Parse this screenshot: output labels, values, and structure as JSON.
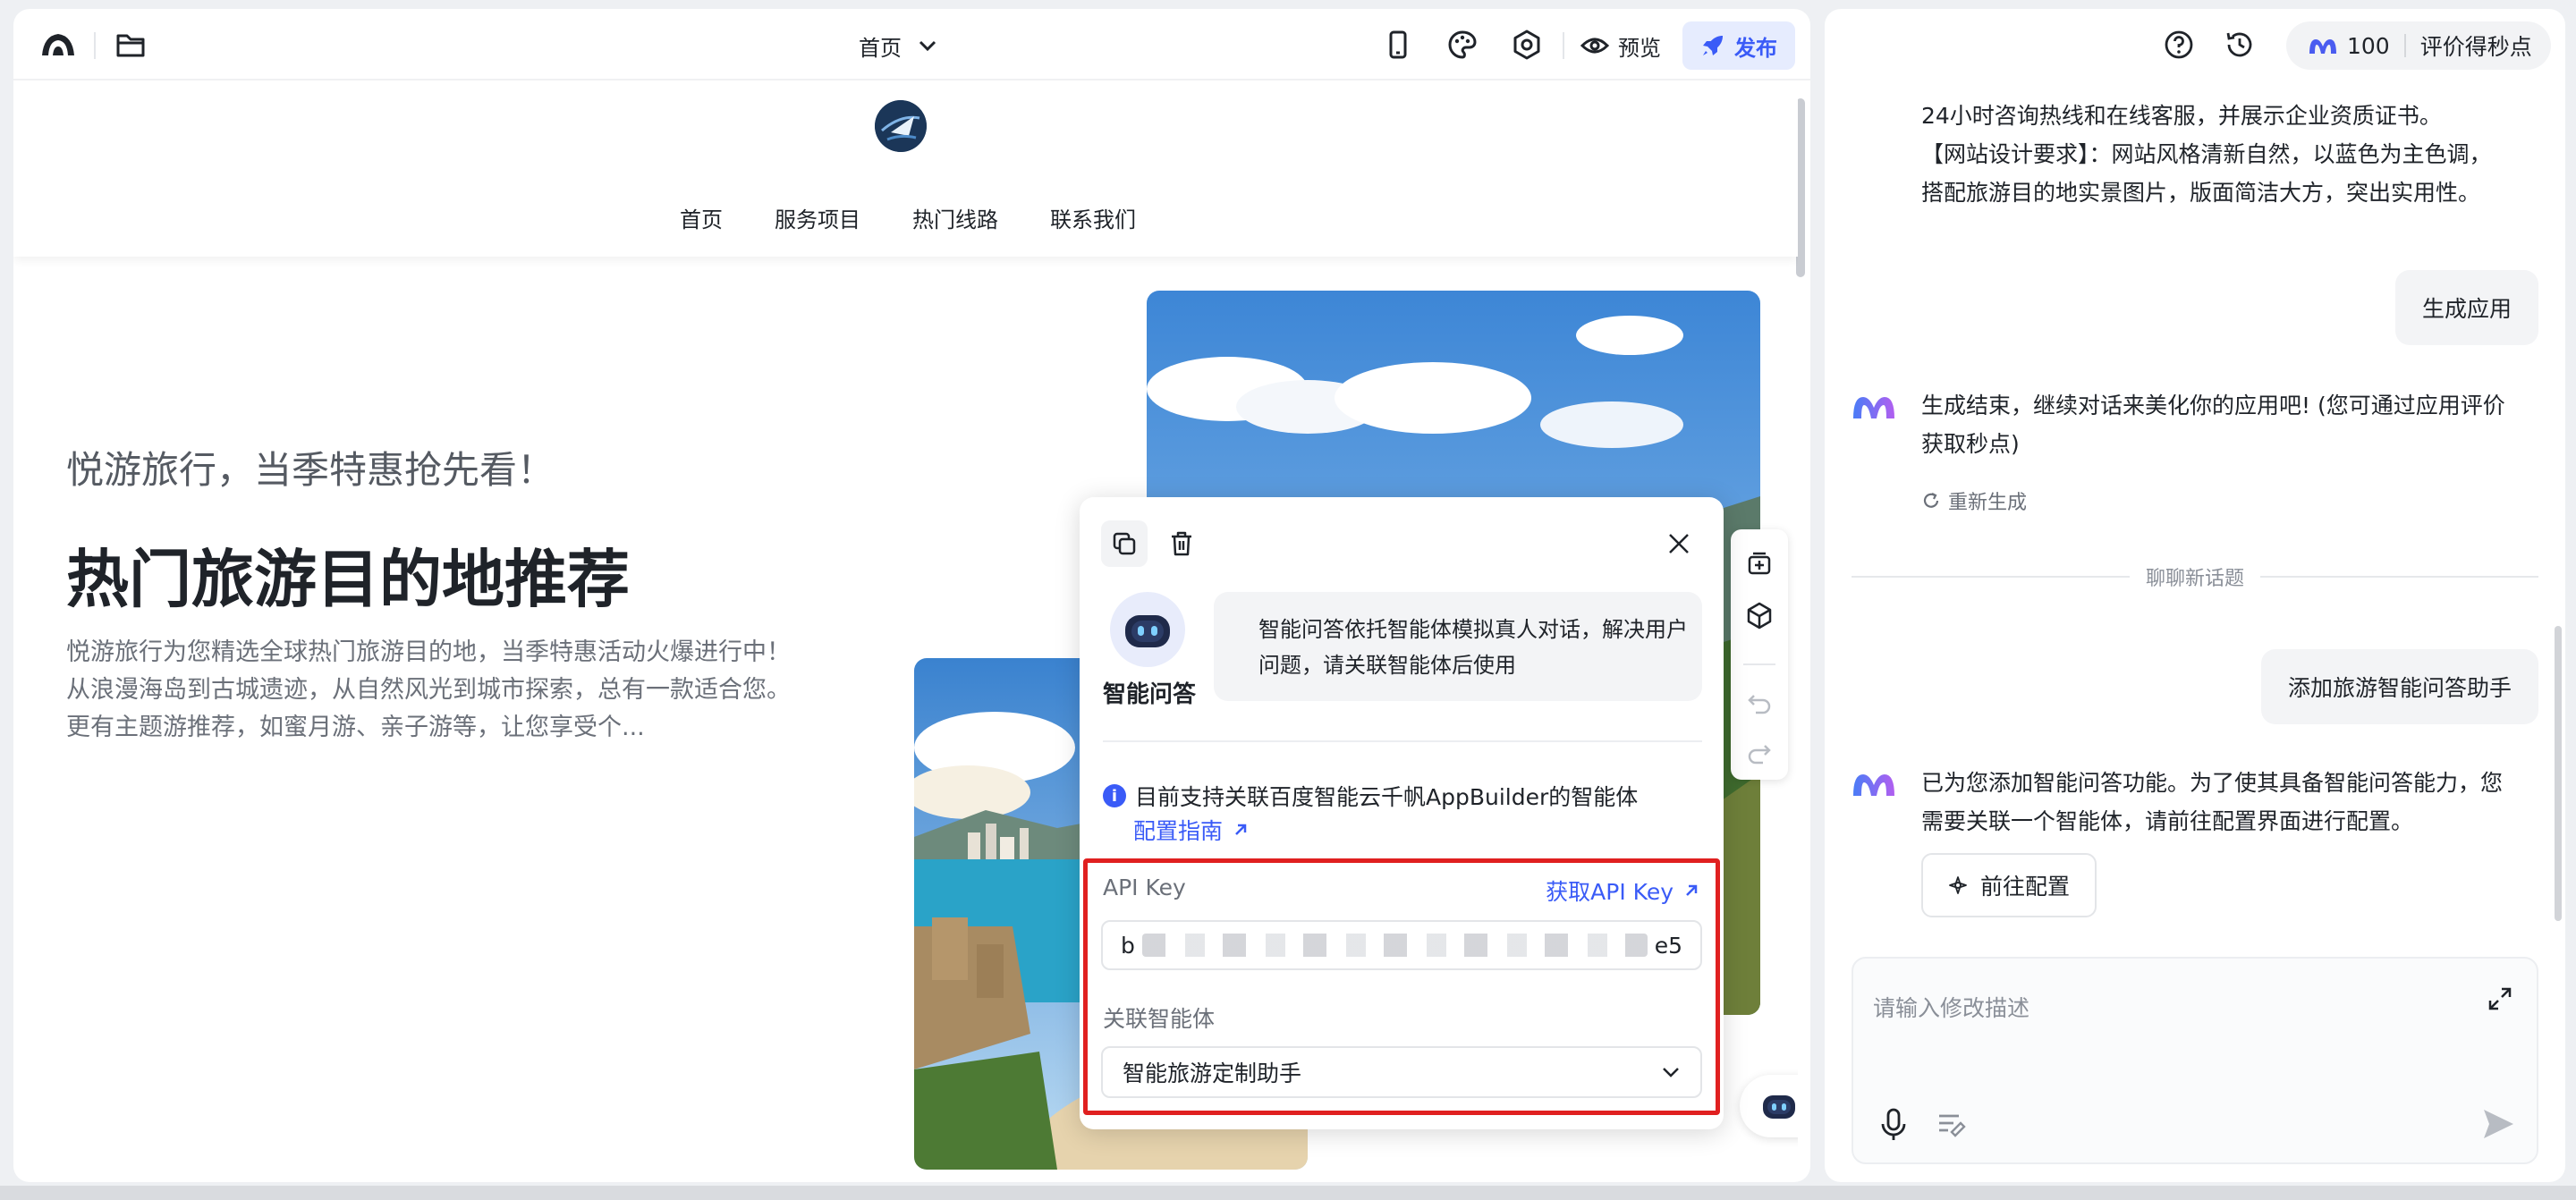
{
  "toolbar": {
    "page_select": "首页",
    "preview_label": "预览",
    "publish_label": "发布"
  },
  "site": {
    "nav": [
      "首页",
      "服务项目",
      "热门线路",
      "联系我们"
    ],
    "hero_subtitle": "悦游旅行，当季特惠抢先看！",
    "hero_title": "热门旅游目的地推荐",
    "hero_desc": "悦游旅行为您精选全球热门旅游目的地，当季特惠活动火爆进行中！从浪漫海岛到古城遗迹，从自然风光到城市探索，总有一款适合您。更有主题游推荐，如蜜月游、亲子游等，让您享受个..."
  },
  "popup": {
    "bot_name": "智能问答",
    "bot_desc": "智能问答依托智能体模拟真人对话，解决用户问题，请关联智能体后使用",
    "info_text": "目前支持关联百度智能云千帆AppBuilder的智能体",
    "guide_link": "配置指南",
    "api_key_label": "API Key",
    "api_key_link": "获取API Key",
    "api_key_prefix": "b",
    "api_key_suffix": "e5",
    "agent_label": "关联智能体",
    "agent_value": "智能旅游定制助手"
  },
  "chat": {
    "credits_count": "100",
    "credits_label": "评价得秒点",
    "prev_text_line1": "24小时咨询热线和在线客服，并展示企业资质证书。",
    "prev_text_line2": "【网站设计要求】：网站风格清新自然，以蓝色为主色调，",
    "prev_text_line3": "搭配旅游目的地实景图片，版面简洁大方，突出实用性。",
    "user_msg_1": "生成应用",
    "ai_msg_1_line1": "生成结束，继续对话来美化你的应用吧! (您可通过应用评价",
    "ai_msg_1_line2": "获取秒点)",
    "regenerate": "重新生成",
    "new_topic": "聊聊新话题",
    "user_msg_2": "添加旅游智能问答助手",
    "ai_msg_2_line1": "已为您添加智能问答功能。为了使其具备智能问答能力，您",
    "ai_msg_2_line2": "需要关联一个智能体，请前往配置界面进行配置。",
    "goto_config": "前往配置",
    "input_placeholder": "请输入修改描述"
  },
  "colors": {
    "accent": "#3a5bf7",
    "highlight_border": "#e02020"
  }
}
